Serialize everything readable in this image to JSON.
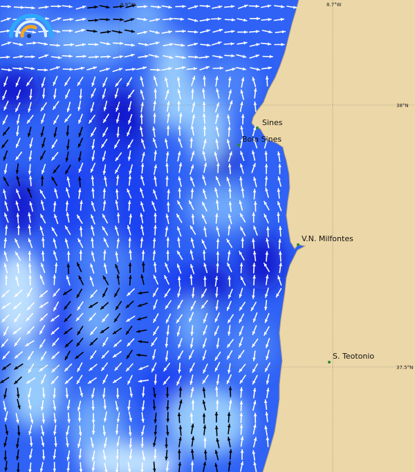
{
  "map": {
    "grid": {
      "longitude_labels": [
        {
          "id": "lon-left",
          "text": "8.9°W"
        },
        {
          "id": "lon-right",
          "text": "8.7°W"
        }
      ],
      "latitude_labels": [
        {
          "id": "lat-top",
          "text": "38°N"
        },
        {
          "id": "lat-bottom",
          "text": "37.5°N"
        }
      ]
    },
    "places": [
      {
        "id": "sines",
        "name": "Sines"
      },
      {
        "id": "boia-sines",
        "name": "Boia Sines"
      },
      {
        "id": "vn-milfontes",
        "name": "V.N. Milfontes"
      },
      {
        "id": "s-teotonio",
        "name": "S. Teotonio"
      }
    ],
    "colors": {
      "land": "#ecd7a8",
      "coast_line": "#b9a27a",
      "marker": "#2c8a2c",
      "arrow_light": "#ffffff",
      "arrow_dark": "#000000",
      "scale": [
        "#0a12c8",
        "#1a3cf0",
        "#2f62f5",
        "#4f86f8",
        "#79b4fb",
        "#a9ddfd",
        "#d6f6ff"
      ]
    },
    "logo_icon": "gauge-logo-icon"
  }
}
